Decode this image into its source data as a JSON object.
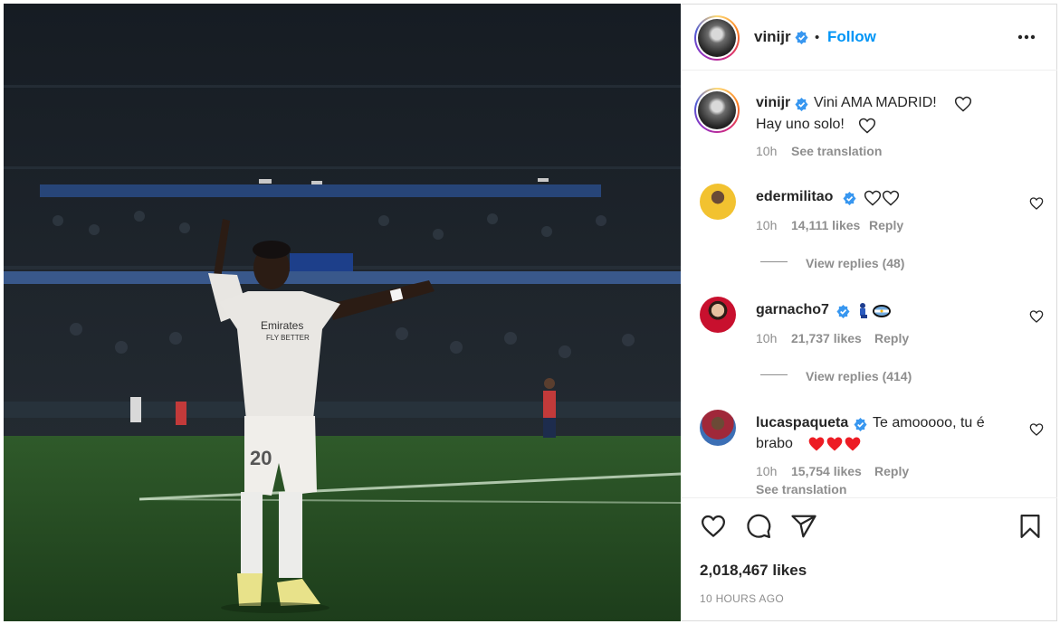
{
  "post": {
    "username": "vinijr",
    "follow_label": "Follow",
    "separator": "•",
    "more_icon": "more-options-icon"
  },
  "caption": {
    "username": "vinijr",
    "line1": "Vini AMA MADRID!",
    "line2": "Hay uno solo!",
    "time": "10h",
    "see_translation": "See translation"
  },
  "comments": [
    {
      "username": "edermilitao",
      "text": "",
      "time": "10h",
      "likes": "14,111 likes",
      "reply": "Reply",
      "view_replies": "View replies (48)",
      "avatar_color": "#f2c230"
    },
    {
      "username": "garnacho7",
      "text": "",
      "time": "10h",
      "likes": "21,737 likes",
      "reply": "Reply",
      "view_replies": "View replies (414)",
      "avatar_color": "#c8102e"
    },
    {
      "username": "lucaspaqueta",
      "text_line1": "Te amooooo, tu é",
      "text_line2": "brabo",
      "time": "10h",
      "likes": "15,754 likes",
      "reply": "Reply",
      "see_translation": "See translation",
      "avatar_color": "#3c6fb5"
    }
  ],
  "footer": {
    "likes": "2,018,467 likes",
    "time": "10 HOURS AGO"
  },
  "colors": {
    "accent": "#0095f6",
    "verified": "#3897f0",
    "heart_red": "#ed1c24"
  }
}
